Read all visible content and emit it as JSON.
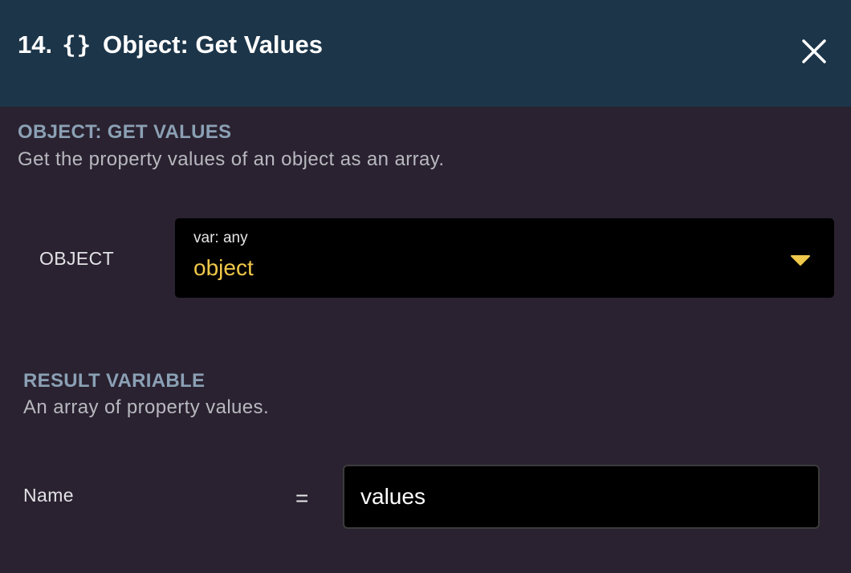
{
  "header": {
    "step_number": "14.",
    "block_icon": "{}",
    "title": "Object: Get Values",
    "close_icon": "close-icon"
  },
  "block": {
    "heading": "OBJECT: GET VALUES",
    "description": "Get the property values of an object as an array."
  },
  "object_field": {
    "label": "OBJECT",
    "var_type": "var: any",
    "value": "object",
    "caret_icon": "caret-down-icon"
  },
  "result": {
    "heading": "RESULT VARIABLE",
    "description": "An array of property values.",
    "name_label": "Name",
    "equals": "=",
    "name_value": "values"
  },
  "colors": {
    "header_bg": "#1c3549",
    "panel_bg": "#2a2230",
    "heading": "#8ba0b5",
    "var_value": "#f0c84a",
    "caret": "#f0c84a",
    "field_bg": "#000000"
  }
}
